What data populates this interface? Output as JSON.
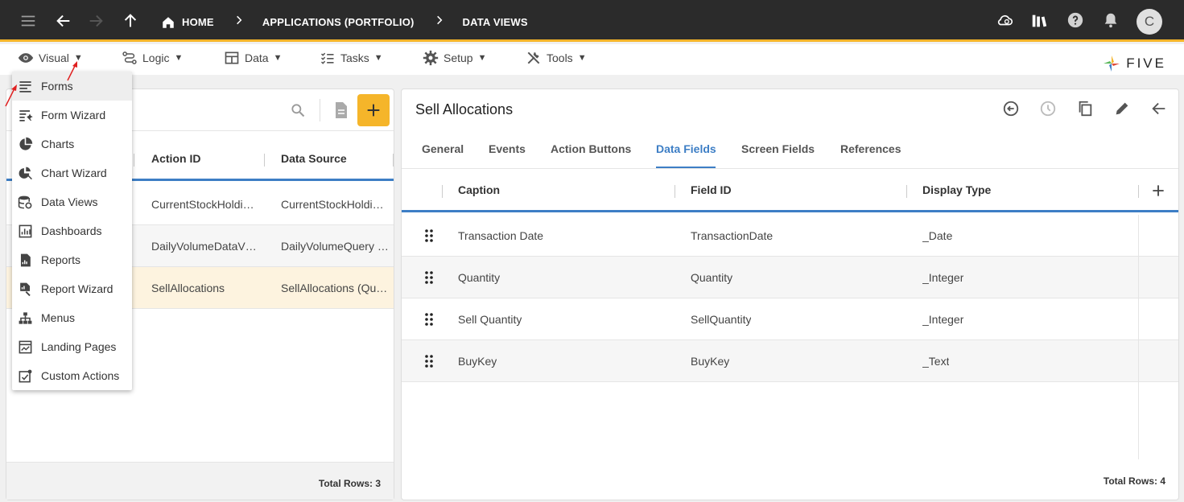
{
  "breadcrumb": {
    "home": "HOME",
    "applications": "APPLICATIONS (PORTFOLIO)",
    "dataviews": "DATA VIEWS"
  },
  "user": {
    "avatar_initial": "C"
  },
  "menubar": {
    "visual": "Visual",
    "logic": "Logic",
    "data": "Data",
    "tasks": "Tasks",
    "setup": "Setup",
    "tools": "Tools",
    "caret": "▼",
    "logo": "FIVE"
  },
  "visual_menu": [
    {
      "label": "Forms",
      "icon": "forms-icon"
    },
    {
      "label": "Form Wizard",
      "icon": "form-wizard-icon"
    },
    {
      "label": "Charts",
      "icon": "charts-icon"
    },
    {
      "label": "Chart Wizard",
      "icon": "chart-wizard-icon"
    },
    {
      "label": "Data Views",
      "icon": "data-views-icon"
    },
    {
      "label": "Dashboards",
      "icon": "dashboards-icon"
    },
    {
      "label": "Reports",
      "icon": "reports-icon"
    },
    {
      "label": "Report Wizard",
      "icon": "report-wizard-icon"
    },
    {
      "label": "Menus",
      "icon": "menus-icon"
    },
    {
      "label": "Landing Pages",
      "icon": "landing-pages-icon"
    },
    {
      "label": "Custom Actions",
      "icon": "custom-actions-icon"
    }
  ],
  "list": {
    "columns": [
      "Action ID",
      "Data Source"
    ],
    "rows": [
      {
        "action_id": "CurrentStockHoldi…",
        "data_source": "CurrentStockHoldi…"
      },
      {
        "action_id": "DailyVolumeDataV…",
        "data_source": "DailyVolumeQuery …"
      },
      {
        "action_id": "SellAllocations",
        "data_source": "SellAllocations (Qu…"
      }
    ],
    "total": "Total Rows: 3"
  },
  "detail": {
    "title": "Sell Allocations",
    "tabs": [
      "General",
      "Events",
      "Action Buttons",
      "Data Fields",
      "Screen Fields",
      "References"
    ],
    "active_tab": "Data Fields",
    "columns": [
      "Caption",
      "Field ID",
      "Display Type"
    ],
    "rows": [
      {
        "caption": "Transaction Date",
        "field_id": "TransactionDate",
        "display_type": "_Date"
      },
      {
        "caption": "Quantity",
        "field_id": "Quantity",
        "display_type": "_Integer"
      },
      {
        "caption": "Sell Quantity",
        "field_id": "SellQuantity",
        "display_type": "_Integer"
      },
      {
        "caption": "BuyKey",
        "field_id": "BuyKey",
        "display_type": "_Text"
      }
    ],
    "total": "Total Rows: 4"
  },
  "colors": {
    "accent": "#f5b52a",
    "active_tab": "#3d7ec5",
    "topbar": "#2b2b2b",
    "annotation_arrow": "#e02020"
  }
}
